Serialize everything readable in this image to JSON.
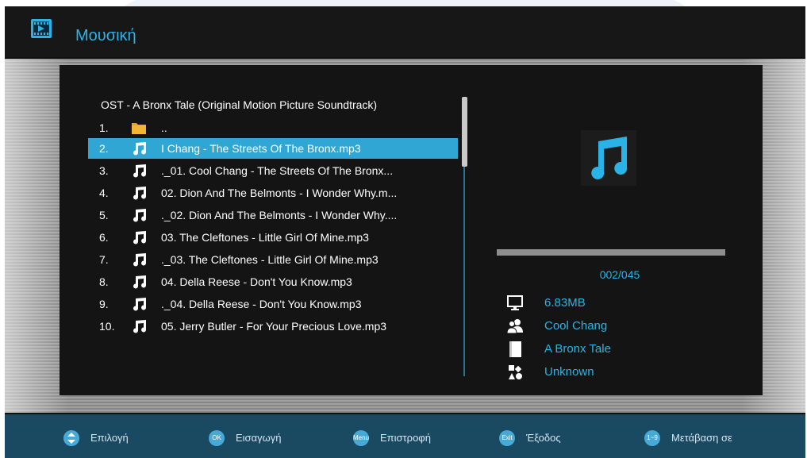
{
  "header": {
    "title": "Μουσική"
  },
  "browser": {
    "folder_path": "OST - A Bronx Tale (Original Motion Picture Soundtrack)",
    "items": [
      {
        "num": "1.",
        "type": "folder",
        "name": ".."
      },
      {
        "num": "2.",
        "type": "audio",
        "name": "I Chang - The Streets Of The Bronx.mp3",
        "selected": true
      },
      {
        "num": "3.",
        "type": "audio",
        "name": "._01. Cool Chang - The Streets Of The Bronx..."
      },
      {
        "num": "4.",
        "type": "audio",
        "name": "02. Dion And The Belmonts - I Wonder Why.m..."
      },
      {
        "num": "5.",
        "type": "audio",
        "name": "._02. Dion And The Belmonts - I Wonder Why...."
      },
      {
        "num": "6.",
        "type": "audio",
        "name": "03. The Cleftones - Little Girl Of Mine.mp3"
      },
      {
        "num": "7.",
        "type": "audio",
        "name": "._03. The Cleftones - Little Girl Of Mine.mp3"
      },
      {
        "num": "8.",
        "type": "audio",
        "name": "04. Della Reese - Don't You Know.mp3"
      },
      {
        "num": "9.",
        "type": "audio",
        "name": "._04. Della Reese - Don't You Know.mp3"
      },
      {
        "num": "10.",
        "type": "audio",
        "name": "05. Jerry Butler - For Your Precious Love.mp3"
      }
    ]
  },
  "info": {
    "progress_fraction": 1.0,
    "counter": "002/045",
    "size": "6.83MB",
    "artist": "Cool Chang",
    "album": "A Bronx Tale",
    "genre": "Unknown"
  },
  "footer": {
    "items": [
      {
        "key": "",
        "label": "Επιλογή"
      },
      {
        "key": "OK",
        "label": "Εισαγωγή"
      },
      {
        "key": "Menu",
        "label": "Επιστροφή"
      },
      {
        "key": "Exit",
        "label": "Έξοδος"
      },
      {
        "key": "1~9",
        "label": "Μετάβαση σε"
      }
    ]
  },
  "colors": {
    "accent": "#2ab3e6",
    "selected_row": "#2fa6d3",
    "footer_bg": "#1a4a62"
  },
  "icons": {
    "header": "film-play-icon",
    "folder": "folder-icon",
    "audio": "music-note-icon",
    "size": "monitor-icon",
    "artist": "people-icon",
    "album": "book-icon",
    "genre": "shapes-icon",
    "footer_nav": "up-down-arrows-icon"
  }
}
